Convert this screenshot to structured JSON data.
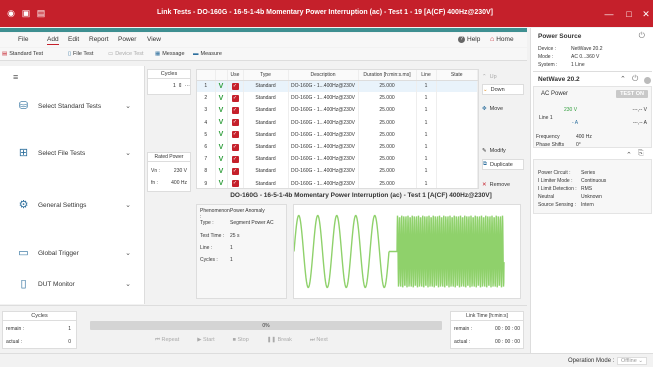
{
  "window": {
    "title": "Link Tests - DO-160G - 16-5-1-4b Momentary Power Interruption (ac) - Test 1 - 19 [A(CF) 400Hz@230V]"
  },
  "menu": {
    "file": "File",
    "add": "Add",
    "edit": "Edit",
    "report": "Report",
    "power": "Power",
    "view": "View",
    "help": "Help",
    "home": "Home"
  },
  "toolbar": {
    "standard_test": "Standard Test",
    "file_test": "File Test",
    "device_test": "Device Test",
    "message": "Message",
    "measure": "Measure"
  },
  "sidebar": {
    "items": [
      {
        "label": "Select Standard Tests",
        "icon": "database-icon"
      },
      {
        "label": "Select File Tests",
        "icon": "add-file-icon"
      },
      {
        "label": "General Settings",
        "icon": "gear-icon"
      },
      {
        "label": "Global Trigger",
        "icon": "trigger-icon"
      },
      {
        "label": "DUT Monitor",
        "icon": "monitor-icon"
      }
    ]
  },
  "cycles_panel": {
    "header": "Cycles",
    "value": "1",
    "rated_power": "Rated Power",
    "vn_label": "Vn :",
    "vn_value": "230 V",
    "fn_label": "fn :",
    "fn_value": "400 Hz"
  },
  "table": {
    "headers": [
      "",
      "Use",
      "Type",
      "Description",
      "Duration [h:min:s.ms]",
      "Line",
      "State"
    ],
    "rows": [
      {
        "num": "1",
        "type": "Standard",
        "desc": "DO-160G - 1...400Hz@230V",
        "dur": "25.000",
        "line": "1"
      },
      {
        "num": "2",
        "type": "Standard",
        "desc": "DO-160G - 1...400Hz@230V",
        "dur": "25.000",
        "line": "1"
      },
      {
        "num": "3",
        "type": "Standard",
        "desc": "DO-160G - 1...400Hz@230V",
        "dur": "25.000",
        "line": "1"
      },
      {
        "num": "4",
        "type": "Standard",
        "desc": "DO-160G - 1...400Hz@230V",
        "dur": "25.000",
        "line": "1"
      },
      {
        "num": "5",
        "type": "Standard",
        "desc": "DO-160G - 1...400Hz@230V",
        "dur": "25.000",
        "line": "1"
      },
      {
        "num": "6",
        "type": "Standard",
        "desc": "DO-160G - 1...400Hz@230V",
        "dur": "25.000",
        "line": "1"
      },
      {
        "num": "7",
        "type": "Standard",
        "desc": "DO-160G - 1...400Hz@230V",
        "dur": "25.000",
        "line": "1"
      },
      {
        "num": "8",
        "type": "Standard",
        "desc": "DO-160G - 1...400Hz@230V",
        "dur": "25.000",
        "line": "1"
      },
      {
        "num": "9",
        "type": "Standard",
        "desc": "DO-160G - 1...400Hz@230V",
        "dur": "25.000",
        "line": "1"
      }
    ]
  },
  "actions": {
    "up": "Up",
    "down": "Down",
    "move": "Move",
    "modify": "Modify",
    "duplicate": "Duplicate",
    "remove": "Remove"
  },
  "detail": {
    "title": "DO-160G - 16-5-1-4b Momentary Power Interruption (ac) - Test 1 [A(CF) 400Hz@230V]",
    "phenomenon_k": "Phenomenon :",
    "phenomenon_v": "Power Anomaly",
    "type_k": "Type :",
    "type_v": "Segment Power AC",
    "time_k": "Test Time :",
    "time_v": "25 s",
    "line_k": "Line :",
    "line_v": "1",
    "cycles_k": "Cycles :",
    "cycles_v": "1"
  },
  "bottom": {
    "cycles_header": "Cycles",
    "remain_k": "remain :",
    "remain_v": "1",
    "actual_k": "actual :",
    "actual_v": "0",
    "progress": "0%",
    "progress_value": 0,
    "repeat": "Repeat",
    "start": "Start",
    "stop": "Stop",
    "break": "Break",
    "next": "Next",
    "time_header": "Link Time [h:min:s]",
    "t_remain_v": "00 : 00 : 00",
    "t_actual_v": "00 : 00 : 00"
  },
  "right": {
    "title": "Power Source",
    "device_k": "Device :",
    "device_v": "NetWave 20.2",
    "mode_k": "Mode :",
    "mode_v": "AC 0...360 V",
    "system_k": "System :",
    "system_v": "1 Line",
    "nw_title": "NetWave 20.2",
    "ac_power": "AC Power",
    "test_on": "TEST ON",
    "line1": "Line 1",
    "v_set": "230 V",
    "a_set": "- A",
    "v_meas": "---,-- V",
    "a_meas": "---,-- A",
    "freq_k": "Frequency",
    "freq_v": "400 Hz",
    "phase_k": "Phase Shifts",
    "phase_v": "0°",
    "pc_k": "Power Circuit :",
    "pc_v": "Series",
    "lm_k": "I Limiter Mode :",
    "lm_v": "Continuous",
    "ld_k": "I Limit Detection :",
    "ld_v": "RMS",
    "neutral_k": "Neutral",
    "neutral_v": "Unknown",
    "ss_k": "Source Sensing :",
    "ss_v": "Intern"
  },
  "status": {
    "label": "Operation Mode :",
    "value": "Offline"
  },
  "colors": {
    "brand": "#c5202b",
    "accent": "#3e8f91",
    "wave": "#8fd16b",
    "check": "#2e9d3a"
  }
}
